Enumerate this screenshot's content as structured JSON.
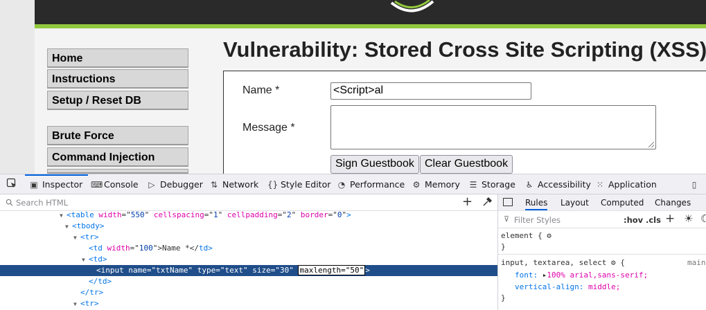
{
  "site": {
    "menu": [
      "Home",
      "Instructions",
      "Setup / Reset DB",
      "Brute Force",
      "Command Injection"
    ],
    "title": "Vulnerability: Stored Cross Site Scripting (XSS)",
    "form": {
      "name_label": "Name *",
      "name_value": "<Script>al",
      "message_label": "Message *",
      "message_value": "",
      "sign_button": "Sign Guestbook",
      "clear_button": "Clear Guestbook"
    },
    "colors": {
      "header": "#2a2a2a",
      "accent_green": "#92c83e"
    }
  },
  "devtools": {
    "tabs": [
      {
        "label": "Inspector",
        "icon": "inspector-icon"
      },
      {
        "label": "Console",
        "icon": "console-icon"
      },
      {
        "label": "Debugger",
        "icon": "debugger-icon"
      },
      {
        "label": "Network",
        "icon": "network-icon"
      },
      {
        "label": "Style Editor",
        "icon": "style-editor-icon"
      },
      {
        "label": "Performance",
        "icon": "performance-icon"
      },
      {
        "label": "Memory",
        "icon": "memory-icon"
      },
      {
        "label": "Storage",
        "icon": "storage-icon"
      },
      {
        "label": "Accessibility",
        "icon": "accessibility-icon"
      },
      {
        "label": "Application",
        "icon": "application-icon"
      }
    ],
    "active_tab": "Inspector",
    "search_placeholder": "Search HTML",
    "html_tree": {
      "table_line": {
        "tag_open": "<table",
        "attrs": [
          [
            "width",
            "550"
          ],
          [
            "cellspacing",
            "1"
          ],
          [
            "cellpadding",
            "2"
          ],
          [
            "border",
            "0"
          ]
        ],
        "tag_close": ">"
      },
      "tbody_line": "<tbody>",
      "tr_line": "<tr>",
      "td_name_line": {
        "open": "<td",
        "attr_name": "width",
        "attr_val": "100",
        "mid": ">Name *</",
        "close": "td>"
      },
      "td_line": "<td>",
      "input_line": {
        "open": "<input",
        "attrs": [
          [
            "name",
            "txtName"
          ],
          [
            "type",
            "text"
          ],
          [
            "size",
            "30"
          ]
        ],
        "edit": "maxlength=\"50\"",
        "close": ">"
      },
      "td_close": "</td>",
      "tr_close": "</tr>",
      "tr_line2": "<tr>"
    },
    "rules_tabs": [
      "Rules",
      "Layout",
      "Computed",
      "Changes"
    ],
    "filter_placeholder": "Filter Styles",
    "hov": ":hov",
    "cls": ".cls",
    "rules": {
      "element_selector": "element {",
      "close": "}",
      "input_selector": "input, textarea, select",
      "source": "main",
      "font_prop": "font:",
      "font_val": "100% arial,sans-serif;",
      "va_prop": "vertical-align:",
      "va_val": "middle;"
    },
    "colors": {
      "selected_row": "#204e8a",
      "active_tab_line": "#0061e0"
    }
  }
}
